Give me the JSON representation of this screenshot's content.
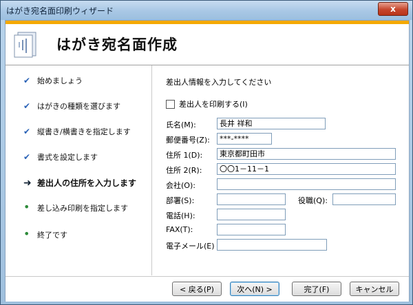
{
  "window": {
    "title": "はがき宛名面印刷ウィザード",
    "close_label": "x"
  },
  "header": {
    "title": "はがき宛名面作成"
  },
  "steps": [
    {
      "label": "始めましょう",
      "status": "done"
    },
    {
      "label": "はがきの種類を選びます",
      "status": "done"
    },
    {
      "label": "縦書き/横書きを指定します",
      "status": "done"
    },
    {
      "label": "書式を設定します",
      "status": "done"
    },
    {
      "label": "差出人の住所を入力します",
      "status": "current"
    },
    {
      "label": "差し込み印刷を指定します",
      "status": "pending"
    },
    {
      "label": "終了です",
      "status": "pending"
    }
  ],
  "form": {
    "instruction": "差出人情報を入力してください",
    "print_sender_label": "差出人を印刷する(I)",
    "fields": {
      "name": {
        "label": "氏名(M):",
        "value": "長井 祥和"
      },
      "postal": {
        "label": "郵便番号(Z):",
        "value": "***-****"
      },
      "address1": {
        "label": "住所 1(D):",
        "value": "東京都町田市"
      },
      "address2": {
        "label": "住所 2(R):",
        "value": "〇〇1－11－1"
      },
      "company": {
        "label": "会社(O):",
        "value": ""
      },
      "department": {
        "label": "部署(S):",
        "value": ""
      },
      "title": {
        "label": "役職(Q):",
        "value": ""
      },
      "phone": {
        "label": "電話(H):",
        "value": ""
      },
      "fax": {
        "label": "FAX(T):",
        "value": ""
      },
      "email": {
        "label": "電子メール(E)",
        "value": ""
      }
    }
  },
  "buttons": {
    "back": "< 戻る(P)",
    "next": "次へ(N) >",
    "finish": "完了(F)",
    "cancel": "キャンセル"
  },
  "colors": {
    "header_accent": "#f4a900",
    "check_mark": "#2a62b6",
    "pending_dot": "#2e8b3a"
  }
}
